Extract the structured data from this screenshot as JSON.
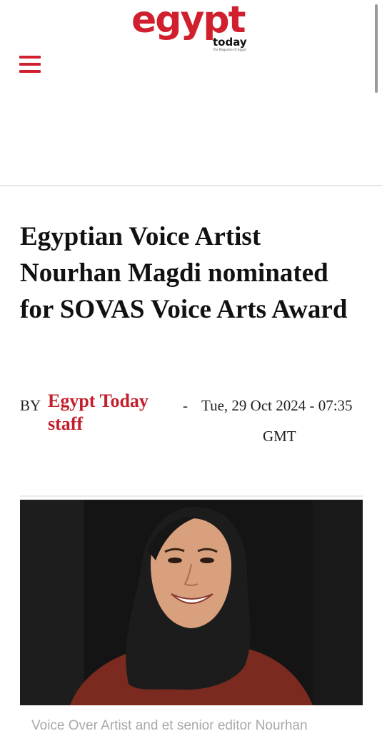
{
  "header": {
    "logo_main": "egypt",
    "logo_sub": "today",
    "logo_tagline": "The Magazine Of Egypt",
    "menu_icon": "hamburger-menu-icon"
  },
  "article": {
    "headline": "Egyptian Voice Artist Nourhan Magdi nominated for SOVAS Voice Arts Award",
    "byline": {
      "prefix": "BY",
      "author": "Egypt Today staff",
      "separator": "-",
      "date": "Tue, 29 Oct 2024 - 07:35",
      "timezone": "GMT"
    },
    "image_caption": "Voice Over Artist and et senior editor Nourhan"
  },
  "colors": {
    "brand_red": "#d0202e",
    "author_red": "#c21f2c",
    "caption_gray": "#a9a9a9"
  }
}
